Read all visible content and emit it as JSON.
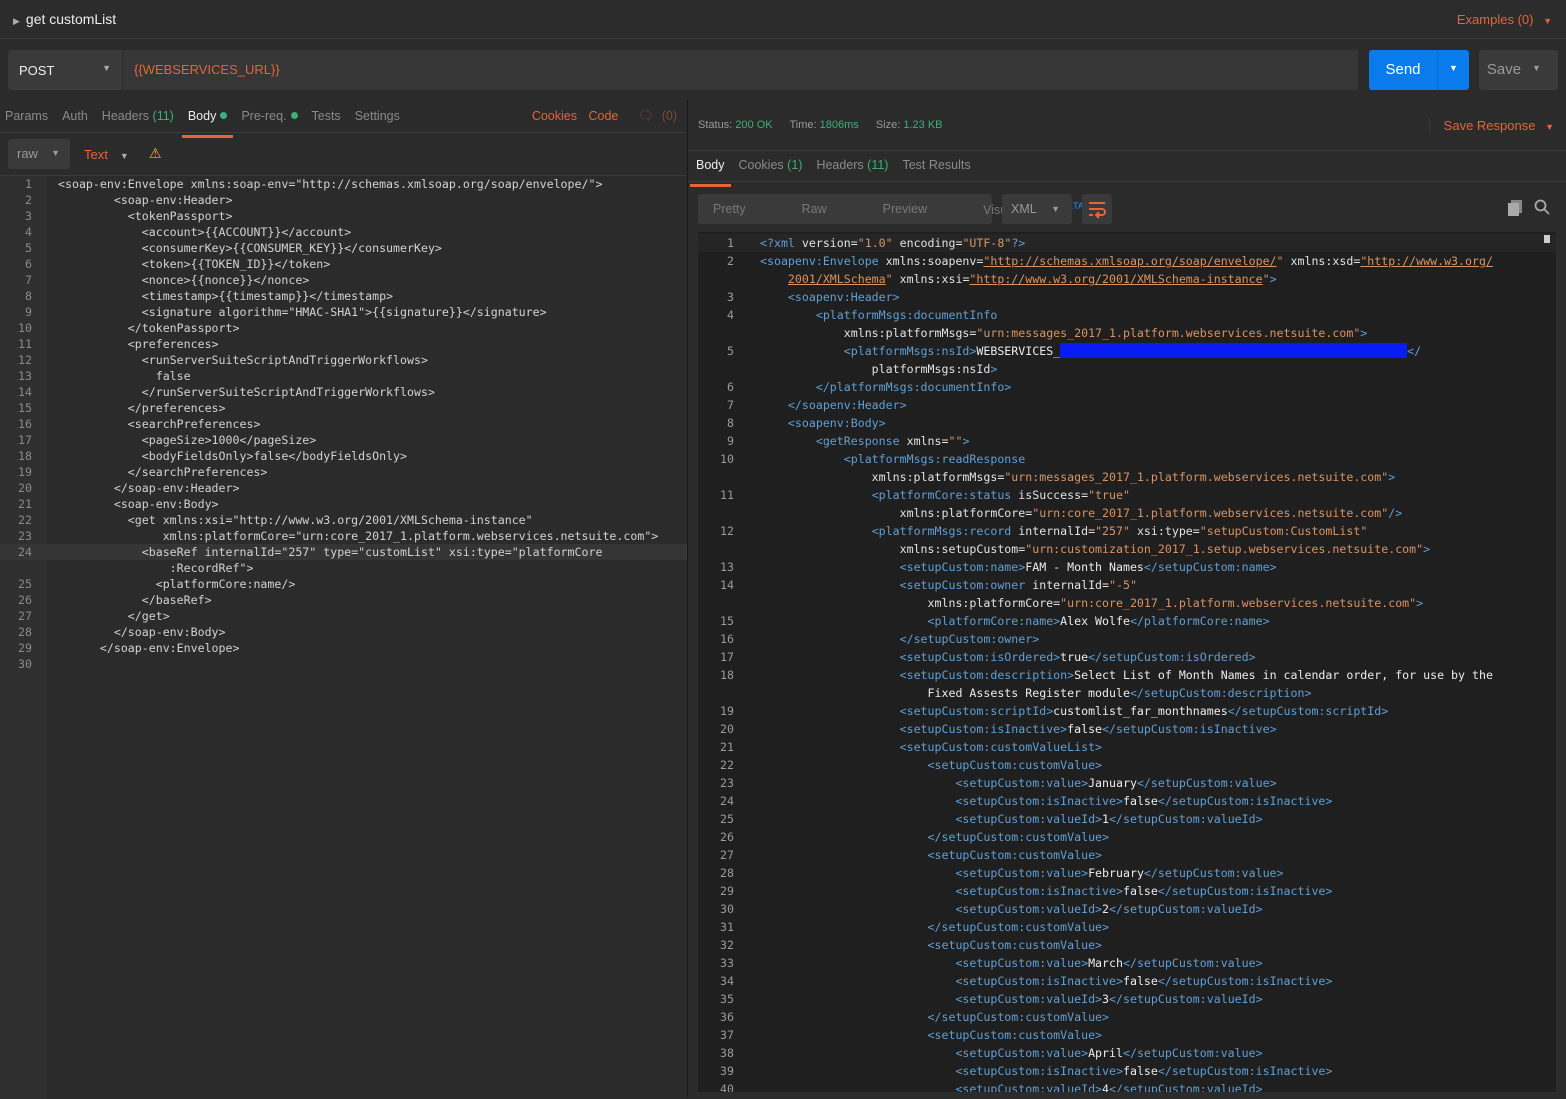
{
  "request": {
    "title": "get customList",
    "examples_label": "Examples (0)",
    "method": "POST",
    "url": "{{WEBSERVICES_URL}}",
    "send_label": "Send",
    "save_label": "Save"
  },
  "request_tabs": [
    {
      "label": "Params"
    },
    {
      "label": "Auth"
    },
    {
      "label": "Headers",
      "count": "(11)"
    },
    {
      "label": "Body",
      "dot": true,
      "active": true
    },
    {
      "label": "Pre-req.",
      "dot": true
    },
    {
      "label": "Tests"
    },
    {
      "label": "Settings"
    }
  ],
  "request_links": {
    "cookies": "Cookies",
    "code": "Code",
    "comments": "(0)"
  },
  "body_mode": {
    "mode": "raw",
    "type": "Text"
  },
  "request_body_lines": [
    {
      "n": "1",
      "t": "<soap-env:Envelope xmlns:soap-env=\"http://schemas.xmlsoap.org/soap/envelope/\">"
    },
    {
      "n": "2",
      "t": "        <soap-env:Header>"
    },
    {
      "n": "3",
      "t": "          <tokenPassport>"
    },
    {
      "n": "4",
      "t": "            <account>{{ACCOUNT}}</account>"
    },
    {
      "n": "5",
      "t": "            <consumerKey>{{CONSUMER_KEY}}</consumerKey>"
    },
    {
      "n": "6",
      "t": "            <token>{{TOKEN_ID}}</token>"
    },
    {
      "n": "7",
      "t": "            <nonce>{{nonce}}</nonce>"
    },
    {
      "n": "8",
      "t": "            <timestamp>{{timestamp}}</timestamp>"
    },
    {
      "n": "9",
      "t": "            <signature algorithm=\"HMAC-SHA1\">{{signature}}</signature>"
    },
    {
      "n": "10",
      "t": "          </tokenPassport>"
    },
    {
      "n": "11",
      "t": "          <preferences>"
    },
    {
      "n": "12",
      "t": "            <runServerSuiteScriptAndTriggerWorkflows>"
    },
    {
      "n": "13",
      "t": "              false"
    },
    {
      "n": "14",
      "t": "            </runServerSuiteScriptAndTriggerWorkflows>"
    },
    {
      "n": "15",
      "t": "          </preferences>"
    },
    {
      "n": "16",
      "t": "          <searchPreferences>"
    },
    {
      "n": "17",
      "t": "            <pageSize>1000</pageSize>"
    },
    {
      "n": "18",
      "t": "            <bodyFieldsOnly>false</bodyFieldsOnly>"
    },
    {
      "n": "19",
      "t": "          </searchPreferences>"
    },
    {
      "n": "20",
      "t": "        </soap-env:Header>"
    },
    {
      "n": "21",
      "t": "        <soap-env:Body>"
    },
    {
      "n": "22",
      "t": "          <get xmlns:xsi=\"http://www.w3.org/2001/XMLSchema-instance\""
    },
    {
      "n": "23",
      "t": "               xmlns:platformCore=\"urn:core_2017_1.platform.webservices.netsuite.com\">"
    },
    {
      "n": "24",
      "t": "            <baseRef internalId=\"257\" type=\"customList\" xsi:type=\"platformCore",
      "current": true
    },
    {
      "n": "",
      "t": "                :RecordRef\">"
    },
    {
      "n": "25",
      "t": "              <platformCore:name/>"
    },
    {
      "n": "26",
      "t": "            </baseRef>"
    },
    {
      "n": "27",
      "t": "          </get>"
    },
    {
      "n": "28",
      "t": "        </soap-env:Body>"
    },
    {
      "n": "29",
      "t": "      </soap-env:Envelope>"
    },
    {
      "n": "30",
      "t": ""
    }
  ],
  "response": {
    "status_label": "Status:",
    "status": "200 OK",
    "time_label": "Time:",
    "time": "1806ms",
    "size_label": "Size:",
    "size": "1.23 KB",
    "save_response": "Save Response",
    "tabs": [
      {
        "label": "Body",
        "active": true
      },
      {
        "label": "Cookies",
        "count": "(1)"
      },
      {
        "label": "Headers",
        "count": "(11)"
      },
      {
        "label": "Test Results"
      }
    ],
    "views": [
      {
        "label": "Pretty",
        "active": true
      },
      {
        "label": "Raw"
      },
      {
        "label": "Preview"
      },
      {
        "label": "Visualize",
        "badge": "BETA"
      }
    ],
    "format": "XML"
  },
  "response_body_lines": [
    {
      "n": "1",
      "t": "<?xml version=\"1.0\" encoding=\"UTF-8\"?>",
      "current": true
    },
    {
      "n": "2",
      "t": "<soapenv:Envelope xmlns:soapenv=\"http://schemas.xmlsoap.org/soap/envelope/\" xmlns:xsd=\"http://www.w3.org/"
    },
    {
      "n": "",
      "t": "    2001/XMLSchema\" xmlns:xsi=\"http://www.w3.org/2001/XMLSchema-instance\">"
    },
    {
      "n": "3",
      "t": "    <soapenv:Header>"
    },
    {
      "n": "4",
      "t": "        <platformMsgs:documentInfo"
    },
    {
      "n": "",
      "t": "            xmlns:platformMsgs=\"urn:messages_2017_1.platform.webservices.netsuite.com\">"
    },
    {
      "n": "5",
      "t": "            <platformMsgs:nsId>WEBSERVICES_",
      "redacted": true,
      "after": "</"
    },
    {
      "n": "",
      "t": "                platformMsgs:nsId>"
    },
    {
      "n": "6",
      "t": "        </platformMsgs:documentInfo>"
    },
    {
      "n": "7",
      "t": "    </soapenv:Header>"
    },
    {
      "n": "8",
      "t": "    <soapenv:Body>"
    },
    {
      "n": "9",
      "t": "        <getResponse xmlns=\"\">"
    },
    {
      "n": "10",
      "t": "            <platformMsgs:readResponse"
    },
    {
      "n": "",
      "t": "                xmlns:platformMsgs=\"urn:messages_2017_1.platform.webservices.netsuite.com\">"
    },
    {
      "n": "11",
      "t": "                <platformCore:status isSuccess=\"true\""
    },
    {
      "n": "",
      "t": "                    xmlns:platformCore=\"urn:core_2017_1.platform.webservices.netsuite.com\"/>"
    },
    {
      "n": "12",
      "t": "                <platformMsgs:record internalId=\"257\" xsi:type=\"setupCustom:CustomList\""
    },
    {
      "n": "",
      "t": "                    xmlns:setupCustom=\"urn:customization_2017_1.setup.webservices.netsuite.com\">"
    },
    {
      "n": "13",
      "t": "                    <setupCustom:name>FAM - Month Names</setupCustom:name>"
    },
    {
      "n": "14",
      "t": "                    <setupCustom:owner internalId=\"-5\""
    },
    {
      "n": "",
      "t": "                        xmlns:platformCore=\"urn:core_2017_1.platform.webservices.netsuite.com\">"
    },
    {
      "n": "15",
      "t": "                        <platformCore:name>Alex Wolfe</platformCore:name>"
    },
    {
      "n": "16",
      "t": "                    </setupCustom:owner>"
    },
    {
      "n": "17",
      "t": "                    <setupCustom:isOrdered>true</setupCustom:isOrdered>"
    },
    {
      "n": "18",
      "t": "                    <setupCustom:description>Select List of Month Names in calendar order, for use by the"
    },
    {
      "n": "",
      "t": "                        Fixed Assests Register module</setupCustom:description>"
    },
    {
      "n": "19",
      "t": "                    <setupCustom:scriptId>customlist_far_monthnames</setupCustom:scriptId>"
    },
    {
      "n": "20",
      "t": "                    <setupCustom:isInactive>false</setupCustom:isInactive>"
    },
    {
      "n": "21",
      "t": "                    <setupCustom:customValueList>"
    },
    {
      "n": "22",
      "t": "                        <setupCustom:customValue>"
    },
    {
      "n": "23",
      "t": "                            <setupCustom:value>January</setupCustom:value>"
    },
    {
      "n": "24",
      "t": "                            <setupCustom:isInactive>false</setupCustom:isInactive>"
    },
    {
      "n": "25",
      "t": "                            <setupCustom:valueId>1</setupCustom:valueId>"
    },
    {
      "n": "26",
      "t": "                        </setupCustom:customValue>"
    },
    {
      "n": "27",
      "t": "                        <setupCustom:customValue>"
    },
    {
      "n": "28",
      "t": "                            <setupCustom:value>February</setupCustom:value>"
    },
    {
      "n": "29",
      "t": "                            <setupCustom:isInactive>false</setupCustom:isInactive>"
    },
    {
      "n": "30",
      "t": "                            <setupCustom:valueId>2</setupCustom:valueId>"
    },
    {
      "n": "31",
      "t": "                        </setupCustom:customValue>"
    },
    {
      "n": "32",
      "t": "                        <setupCustom:customValue>"
    },
    {
      "n": "33",
      "t": "                            <setupCustom:value>March</setupCustom:value>"
    },
    {
      "n": "34",
      "t": "                            <setupCustom:isInactive>false</setupCustom:isInactive>"
    },
    {
      "n": "35",
      "t": "                            <setupCustom:valueId>3</setupCustom:valueId>"
    },
    {
      "n": "36",
      "t": "                        </setupCustom:customValue>"
    },
    {
      "n": "37",
      "t": "                        <setupCustom:customValue>"
    },
    {
      "n": "38",
      "t": "                            <setupCustom:value>April</setupCustom:value>"
    },
    {
      "n": "39",
      "t": "                            <setupCustom:isInactive>false</setupCustom:isInactive>"
    },
    {
      "n": "40",
      "t": "                            <setupCustom:valueId>4</setupCustom:valueId>"
    }
  ],
  "colors": {
    "accent": "#e5643b",
    "send": "#097bed",
    "success": "#3bb07a",
    "xml_tag": "#5f9fd6",
    "xml_string": "#d99363",
    "redaction": "#0a1cf5"
  },
  "icons": [
    "caret-right-icon",
    "caret-down-icon",
    "warning-icon",
    "comment-icon",
    "wrap-lines-icon",
    "copy-icon",
    "search-icon"
  ]
}
